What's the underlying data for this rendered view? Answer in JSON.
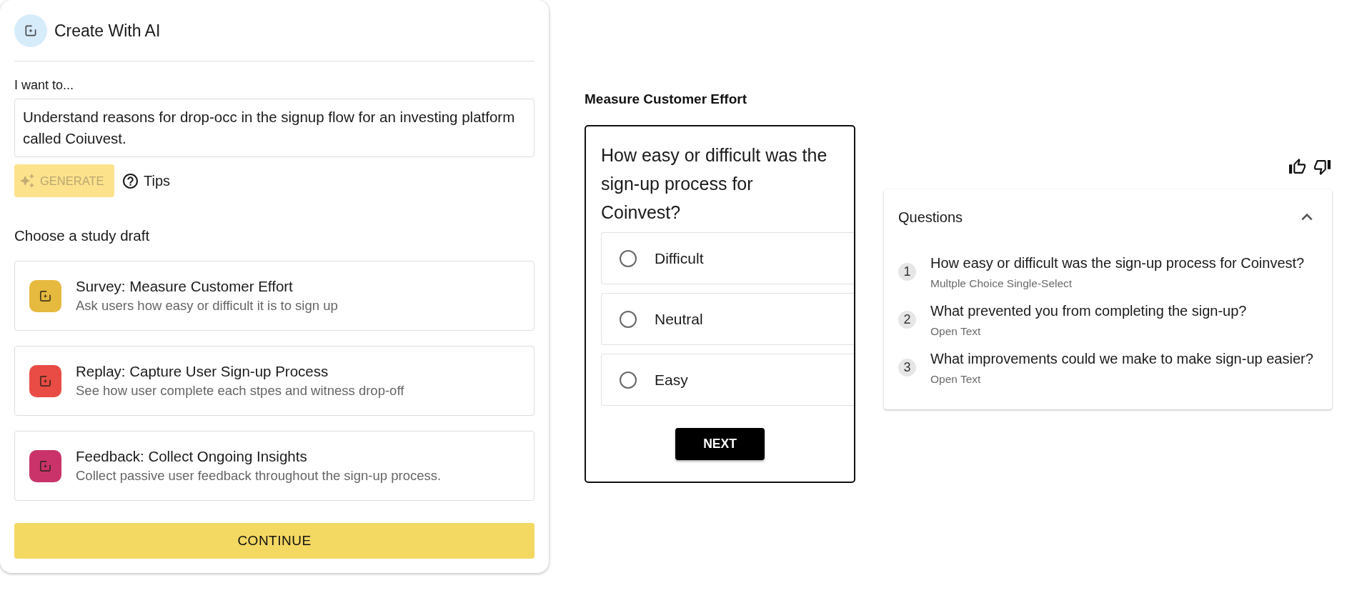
{
  "create_panel": {
    "title": "Create With AI",
    "prompt": {
      "label": "I want to...",
      "value": "Understand reasons for drop-occ in the signup flow for an investing platform called Coiuvest."
    },
    "generate_button": {
      "label": "GENERATE",
      "disabled": true
    },
    "tips_link": "Tips",
    "drafts_heading": "Choose a study draft",
    "drafts": [
      {
        "title": "Survey: Measure Customer Effort",
        "description": "Ask users how easy or difficult it is to sign up",
        "color": "#e6b93f",
        "selected": false
      },
      {
        "title": "Replay: Capture User Sign-up Process",
        "description": "See how user complete each stpes and witness drop-off",
        "color": "#e84c44",
        "selected": false
      },
      {
        "title": "Feedback: Collect Ongoing Insights",
        "description": "Collect passive user feedback throughout the sign-up process.",
        "color": "#c9336a",
        "selected": false
      }
    ],
    "continue_button": "CONTINUE"
  },
  "preview": {
    "title": "Measure Customer Effort",
    "question": "How easy or difficult was the sign-up process for Coinvest?",
    "options": [
      {
        "label": "Difficult",
        "selected": false
      },
      {
        "label": "Neutral",
        "selected": false
      },
      {
        "label": "Easy",
        "selected": false
      }
    ],
    "next_button": "NEXT"
  },
  "questions_panel": {
    "title": "Questions",
    "expanded": true,
    "items": [
      {
        "number": "1",
        "title": "How easy or difficult was the sign-up process for Coinvest?",
        "type": "Multple Choice Single-Select"
      },
      {
        "number": "2",
        "title": "What prevented you from completing the sign-up?",
        "type": "Open Text"
      },
      {
        "number": "3",
        "title": "What improvements could we make to make sign-up easier?",
        "type": "Open Text"
      }
    ]
  }
}
